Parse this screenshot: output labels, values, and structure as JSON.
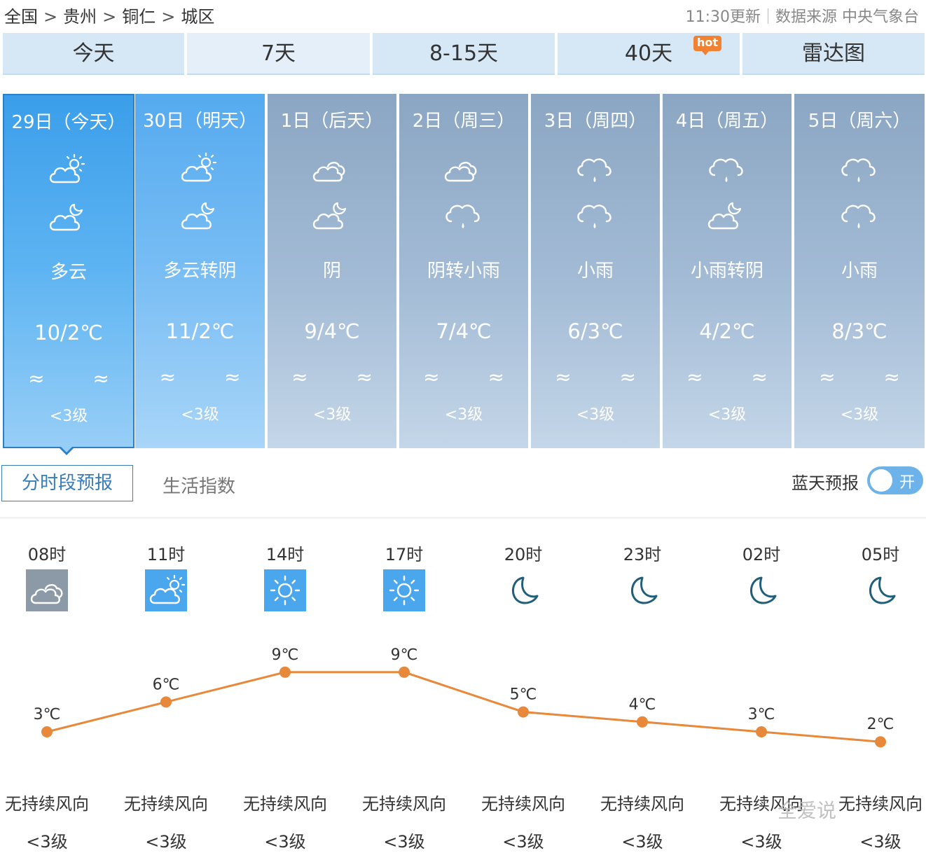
{
  "breadcrumb": [
    "全国",
    "贵州",
    "铜仁",
    "城区"
  ],
  "breadcrumb_sep": ">",
  "update_time": "11:30更新",
  "data_source": "数据来源 中央气象台",
  "tabs": [
    {
      "label": "今天"
    },
    {
      "label": "7天"
    },
    {
      "label": "8-15天"
    },
    {
      "label": "40天",
      "badge": "hot"
    },
    {
      "label": "雷达图"
    }
  ],
  "days": [
    {
      "date": "29日（今天）",
      "icon_day": "partly-cloudy-sun-icon",
      "icon_night": "partly-cloudy-moon-icon",
      "weather": "多云",
      "temp": "10/2℃",
      "wind_icon": "≈ ≈",
      "wind": "<3级"
    },
    {
      "date": "30日（明天）",
      "icon_day": "partly-cloudy-sun-icon",
      "icon_night": "partly-cloudy-moon-icon",
      "weather": "多云转阴",
      "temp": "11/2℃",
      "wind_icon": "≈ ≈",
      "wind": "<3级"
    },
    {
      "date": "1日（后天）",
      "icon_day": "overcast-icon",
      "icon_night": "partly-cloudy-moon-icon",
      "weather": "阴",
      "temp": "9/4℃",
      "wind_icon": "≈ ≈",
      "wind": "<3级"
    },
    {
      "date": "2日（周三）",
      "icon_day": "overcast-icon",
      "icon_night": "light-rain-icon",
      "weather": "阴转小雨",
      "temp": "7/4℃",
      "wind_icon": "≈ ≈",
      "wind": "<3级"
    },
    {
      "date": "3日（周四）",
      "icon_day": "light-rain-icon",
      "icon_night": "light-rain-icon",
      "weather": "小雨",
      "temp": "6/3℃",
      "wind_icon": "≈ ≈",
      "wind": "<3级"
    },
    {
      "date": "4日（周五）",
      "icon_day": "light-rain-icon",
      "icon_night": "partly-cloudy-moon-icon",
      "weather": "小雨转阴",
      "temp": "4/2℃",
      "wind_icon": "≈ ≈",
      "wind": "<3级"
    },
    {
      "date": "5日（周六）",
      "icon_day": "light-rain-icon",
      "icon_night": "light-rain-icon",
      "weather": "小雨",
      "temp": "8/3℃",
      "wind_icon": "≈ ≈",
      "wind": "<3级"
    }
  ],
  "subtabs": {
    "hourly": "分时段预报",
    "life": "生活指数"
  },
  "bluesky": {
    "label": "蓝天预报",
    "toggle": "开"
  },
  "hourly": [
    {
      "hour": "08时",
      "icon": "overcast-icon",
      "temp": "3℃",
      "wind_dir": "无持续风向",
      "wind": "<3级"
    },
    {
      "hour": "11时",
      "icon": "partly-cloudy-sun-icon",
      "temp": "6℃",
      "wind_dir": "无持续风向",
      "wind": "<3级"
    },
    {
      "hour": "14时",
      "icon": "sunny-icon",
      "temp": "9℃",
      "wind_dir": "无持续风向",
      "wind": "<3级"
    },
    {
      "hour": "17时",
      "icon": "sunny-icon",
      "temp": "9℃",
      "wind_dir": "无持续风向",
      "wind": "<3级"
    },
    {
      "hour": "20时",
      "icon": "moon-icon",
      "temp": "5℃",
      "wind_dir": "无持续风向",
      "wind": "<3级"
    },
    {
      "hour": "23时",
      "icon": "moon-icon",
      "temp": "4℃",
      "wind_dir": "无持续风向",
      "wind": "<3级"
    },
    {
      "hour": "02时",
      "icon": "moon-icon",
      "temp": "3℃",
      "wind_dir": "无持续风向",
      "wind": "<3级"
    },
    {
      "hour": "05时",
      "icon": "moon-icon",
      "temp": "2℃",
      "wind_dir": "无持续风向",
      "wind": "<3级"
    }
  ],
  "watermark": "全爱说",
  "chart_data": {
    "type": "line",
    "categories": [
      "08时",
      "11时",
      "14时",
      "17时",
      "20时",
      "23时",
      "02时",
      "05时"
    ],
    "values": [
      3,
      6,
      9,
      9,
      5,
      4,
      3,
      2
    ],
    "point_labels": [
      "3℃",
      "6℃",
      "9℃",
      "9℃",
      "5℃",
      "4℃",
      "3℃",
      "2℃"
    ],
    "line_color": "#e8883a"
  },
  "colors": {
    "accent": "#3a7cb8",
    "line": "#e8883a",
    "today": "#4aa7ee",
    "hot_badge": "#f08232"
  }
}
